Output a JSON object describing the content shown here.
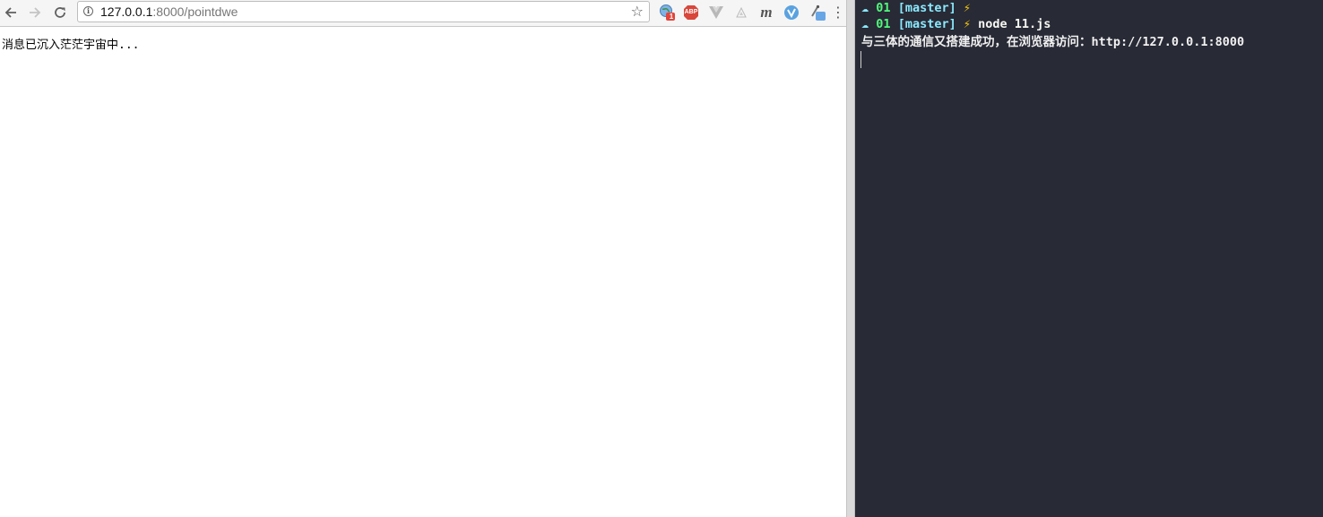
{
  "browser": {
    "url": {
      "host": "127.0.0.1",
      "rest": ":8000/pointdwe"
    },
    "extensions": {
      "badge_count": "1",
      "abp_label": "ABP",
      "m_label": "m"
    },
    "page": {
      "message": "消息已沉入茫茫宇宙中..."
    }
  },
  "terminal": {
    "lines": [
      {
        "icon": "☁",
        "dir": "01",
        "branch": "[master]",
        "bolt": "⚡",
        "command": ""
      },
      {
        "icon": "☁",
        "dir": "01",
        "branch": "[master]",
        "bolt": "⚡",
        "command": "node 11.js"
      }
    ],
    "output": "与三体的通信又搭建成功，在浏览器访问：http://127.0.0.1:8000"
  },
  "colors": {
    "terminal_bg": "#282a36",
    "prompt_dir": "#50fa7b",
    "prompt_branch": "#8be9fd",
    "bolt": "#f1c40f"
  }
}
